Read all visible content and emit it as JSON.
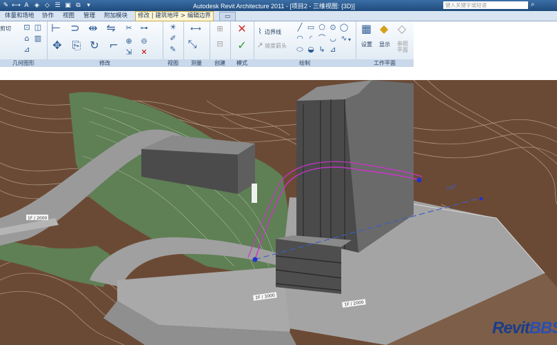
{
  "title_bar": {
    "title": "Autodesk Revit Architecture 2011 - [项目2 - 三维视图: {3D}]",
    "search_placeholder": "键入关键字或短语"
  },
  "tabs": [
    {
      "label": "体量和场地"
    },
    {
      "label": "协作"
    },
    {
      "label": "视图"
    },
    {
      "label": "管理"
    },
    {
      "label": "附加模块"
    },
    {
      "label": "修改 | 建筑地坪 > 编辑边界"
    }
  ],
  "ribbon": {
    "panels": [
      {
        "label": "几何图形"
      },
      {
        "label": "修改"
      },
      {
        "label": "视图"
      },
      {
        "label": "测量"
      },
      {
        "label": "创建"
      },
      {
        "label": "模式"
      },
      {
        "label": "绘制"
      },
      {
        "label": "工作平面"
      }
    ],
    "geometry_cut_label": "剪切",
    "boundary_line_label": "边界线",
    "slope_arrow_label": "坡度箭头",
    "set_label": "设置",
    "show_label": "显示",
    "ref_plane_label": "参照平面"
  },
  "viewport": {
    "annotation_1": "240°",
    "watermark": "RevitBBS",
    "level_labels": [
      "1F / 2000",
      "2F / 3000",
      "1F / 2000",
      "1F / 2000"
    ]
  },
  "colors": {
    "terrain": "#6b4a35",
    "grass": "#5f7f55",
    "pavement": "#a8a8a8",
    "building": "#4d4d4d",
    "sketch_line": "#cc33cc",
    "title_bar": "#2b5a8f"
  }
}
